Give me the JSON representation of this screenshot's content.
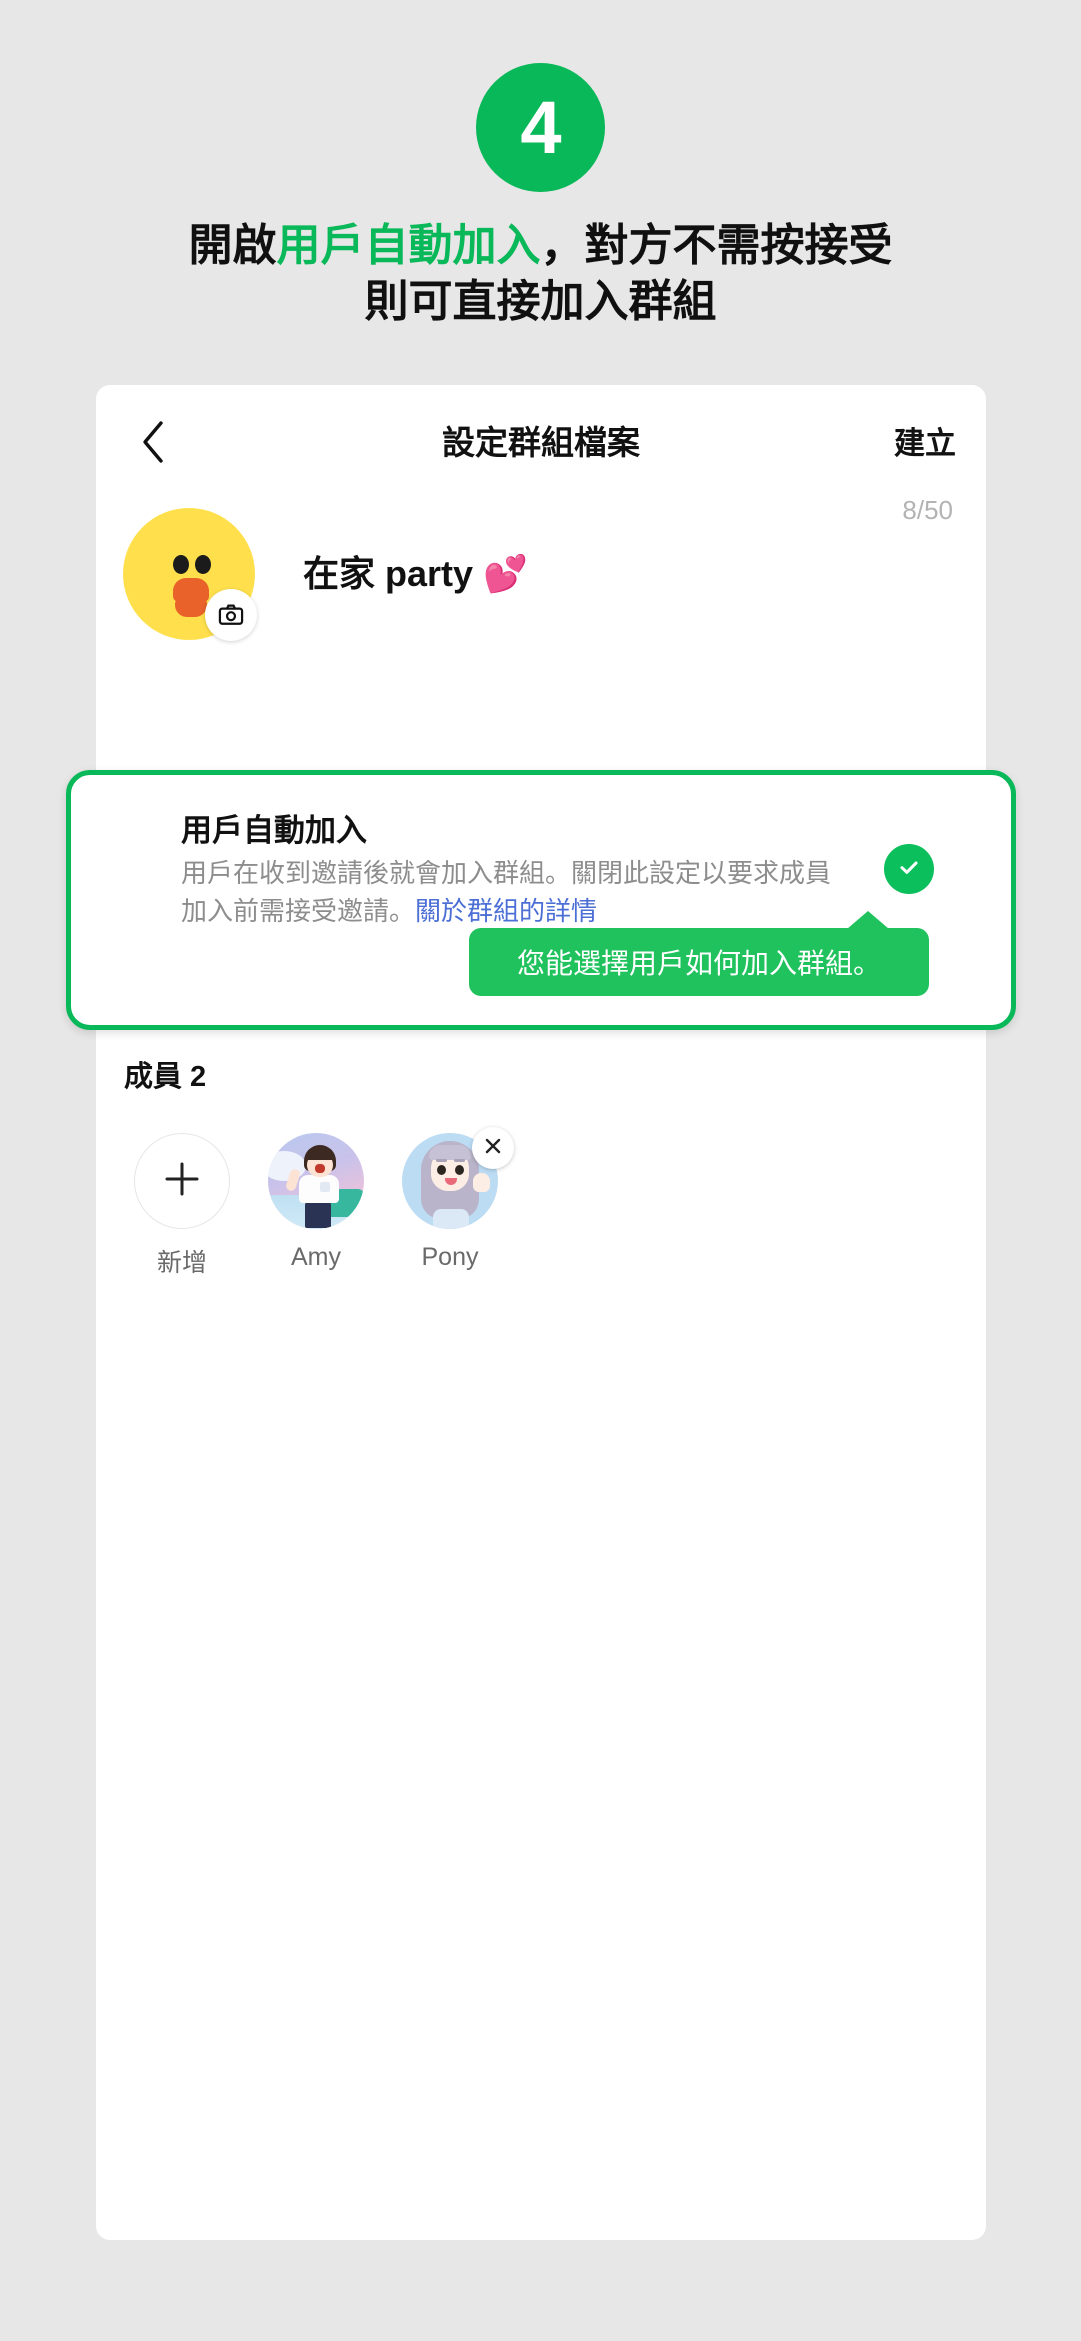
{
  "step": {
    "number": "4",
    "badge_color": "#09B859"
  },
  "headline": {
    "line1_prefix": "開啟",
    "line1_highlight": "用戶自動加入",
    "line1_suffix": "，對方不需按接受",
    "line2": "則可直接加入群組",
    "highlight_color": "#09B859"
  },
  "screen": {
    "header": {
      "back_icon": "chevron-left-icon",
      "title": "設定群組檔案",
      "action_label": "建立"
    },
    "group": {
      "avatar_icon": "sally-duck-avatar",
      "camera_icon": "camera-icon",
      "name": "在家 party 💕",
      "char_count": "8/50"
    },
    "auto_join": {
      "title": "用戶自動加入",
      "description": "用戶在收到邀請後就會加入群組。關閉此設定以要求成員加入前需接受邀請。",
      "link_label": "關於群組的詳情",
      "link_color": "#4C6FD6",
      "toggle_icon": "check-circle-icon",
      "toggle_state": "on",
      "toggle_color": "#0ABF5C",
      "highlight_border_color": "#09B859"
    },
    "tooltip": {
      "text": "您能選擇用戶如何加入群組。",
      "background_color": "#1FC25C"
    },
    "members": {
      "section_label": "成員 2",
      "items": [
        {
          "label": "新增",
          "kind": "add",
          "icon": "plus-icon"
        },
        {
          "label": "Amy",
          "kind": "member",
          "icon": "amy-avatar"
        },
        {
          "label": "Pony",
          "kind": "member",
          "icon": "pony-avatar",
          "remove_icon": "close-icon"
        }
      ]
    }
  }
}
